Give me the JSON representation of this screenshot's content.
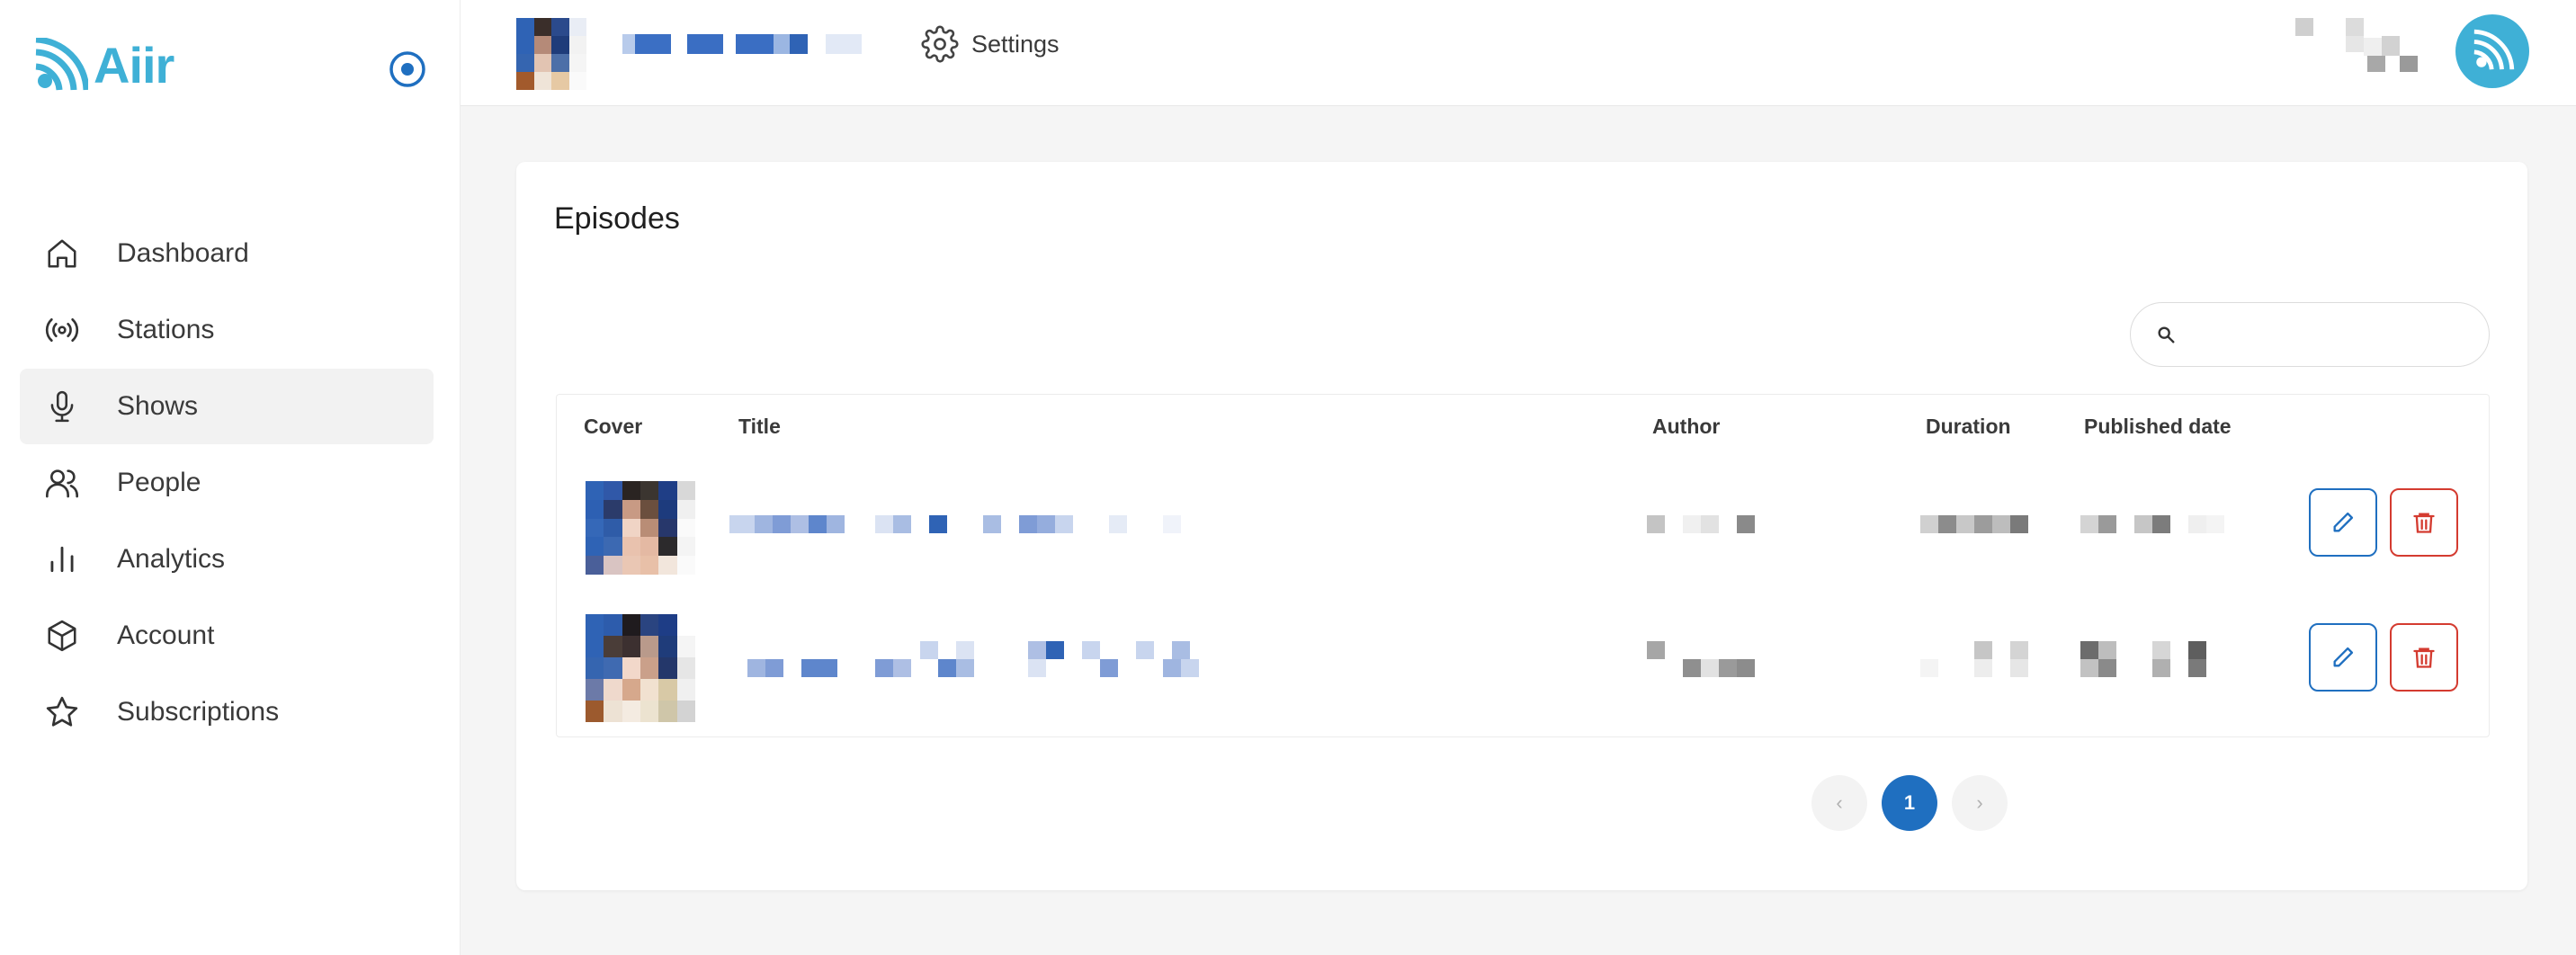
{
  "app": {
    "logo_text": "Aiir"
  },
  "colors": {
    "brand": "#3fb0d6",
    "accent_blue": "#1f6fc0",
    "danger_red": "#d43b30"
  },
  "sidebar": {
    "items": [
      {
        "label": "Dashboard",
        "icon": "home-icon",
        "active": false
      },
      {
        "label": "Stations",
        "icon": "broadcast-icon",
        "active": false
      },
      {
        "label": "Shows",
        "icon": "microphone-icon",
        "active": true
      },
      {
        "label": "People",
        "icon": "users-icon",
        "active": false
      },
      {
        "label": "Analytics",
        "icon": "bar-chart-icon",
        "active": false
      },
      {
        "label": "Account",
        "icon": "box-icon",
        "active": false
      },
      {
        "label": "Subscriptions",
        "icon": "star-icon",
        "active": false
      }
    ]
  },
  "header": {
    "settings_label": "Settings"
  },
  "main": {
    "title": "Episodes",
    "search": {
      "placeholder": "",
      "value": ""
    },
    "table": {
      "columns": [
        "Cover",
        "Title",
        "Author",
        "Duration",
        "Published date"
      ],
      "rows": [
        {
          "cover": "obscured",
          "title": "",
          "author": "",
          "duration": "",
          "published": ""
        },
        {
          "cover": "obscured",
          "title": "",
          "author": "",
          "duration": "",
          "published": ""
        }
      ]
    },
    "pagination": {
      "current_page": "1",
      "prev_label": "‹",
      "next_label": "›"
    }
  }
}
